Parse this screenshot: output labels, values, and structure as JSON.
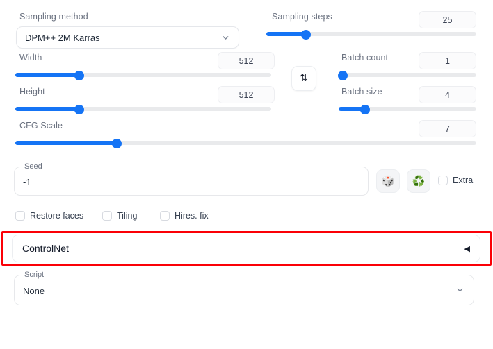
{
  "panel": {
    "sampling_method": {
      "label": "Sampling method",
      "value": "DPM++ 2M Karras",
      "chevron_icon": "chevron-down-icon"
    },
    "sampling_steps": {
      "label": "Sampling steps",
      "value": "25",
      "fill_percent": 19
    },
    "width": {
      "label": "Width",
      "value": "512",
      "fill_percent": 25
    },
    "height": {
      "label": "Height",
      "value": "512",
      "fill_percent": 25
    },
    "cfg_scale": {
      "label": "CFG Scale",
      "value": "7",
      "fill_percent": 22
    },
    "batch_count": {
      "label": "Batch count",
      "value": "1",
      "fill_percent": 0
    },
    "batch_size": {
      "label": "Batch size",
      "value": "4",
      "fill_percent": 17
    },
    "swap_button": {
      "icon": "swap-arrows-icon",
      "glyph": "⇅"
    },
    "seed": {
      "label": "Seed",
      "value": "-1"
    },
    "dice_button": {
      "icon": "dice-icon",
      "glyph": "🎲"
    },
    "recycle_button": {
      "icon": "recycle-icon",
      "glyph": "♻️"
    },
    "extra_checkbox": {
      "label": "Extra",
      "checked": false
    },
    "checkboxes": [
      {
        "label": "Restore faces",
        "checked": false
      },
      {
        "label": "Tiling",
        "checked": false
      },
      {
        "label": "Hires. fix",
        "checked": false
      }
    ],
    "controlnet": {
      "title": "ControlNet",
      "arrow_icon": "triangle-left-icon",
      "glyph": "◀",
      "highlighted": true,
      "highlight_color": "#fb0007"
    },
    "script": {
      "label": "Script",
      "value": "None",
      "chevron_icon": "chevron-down-icon"
    }
  }
}
